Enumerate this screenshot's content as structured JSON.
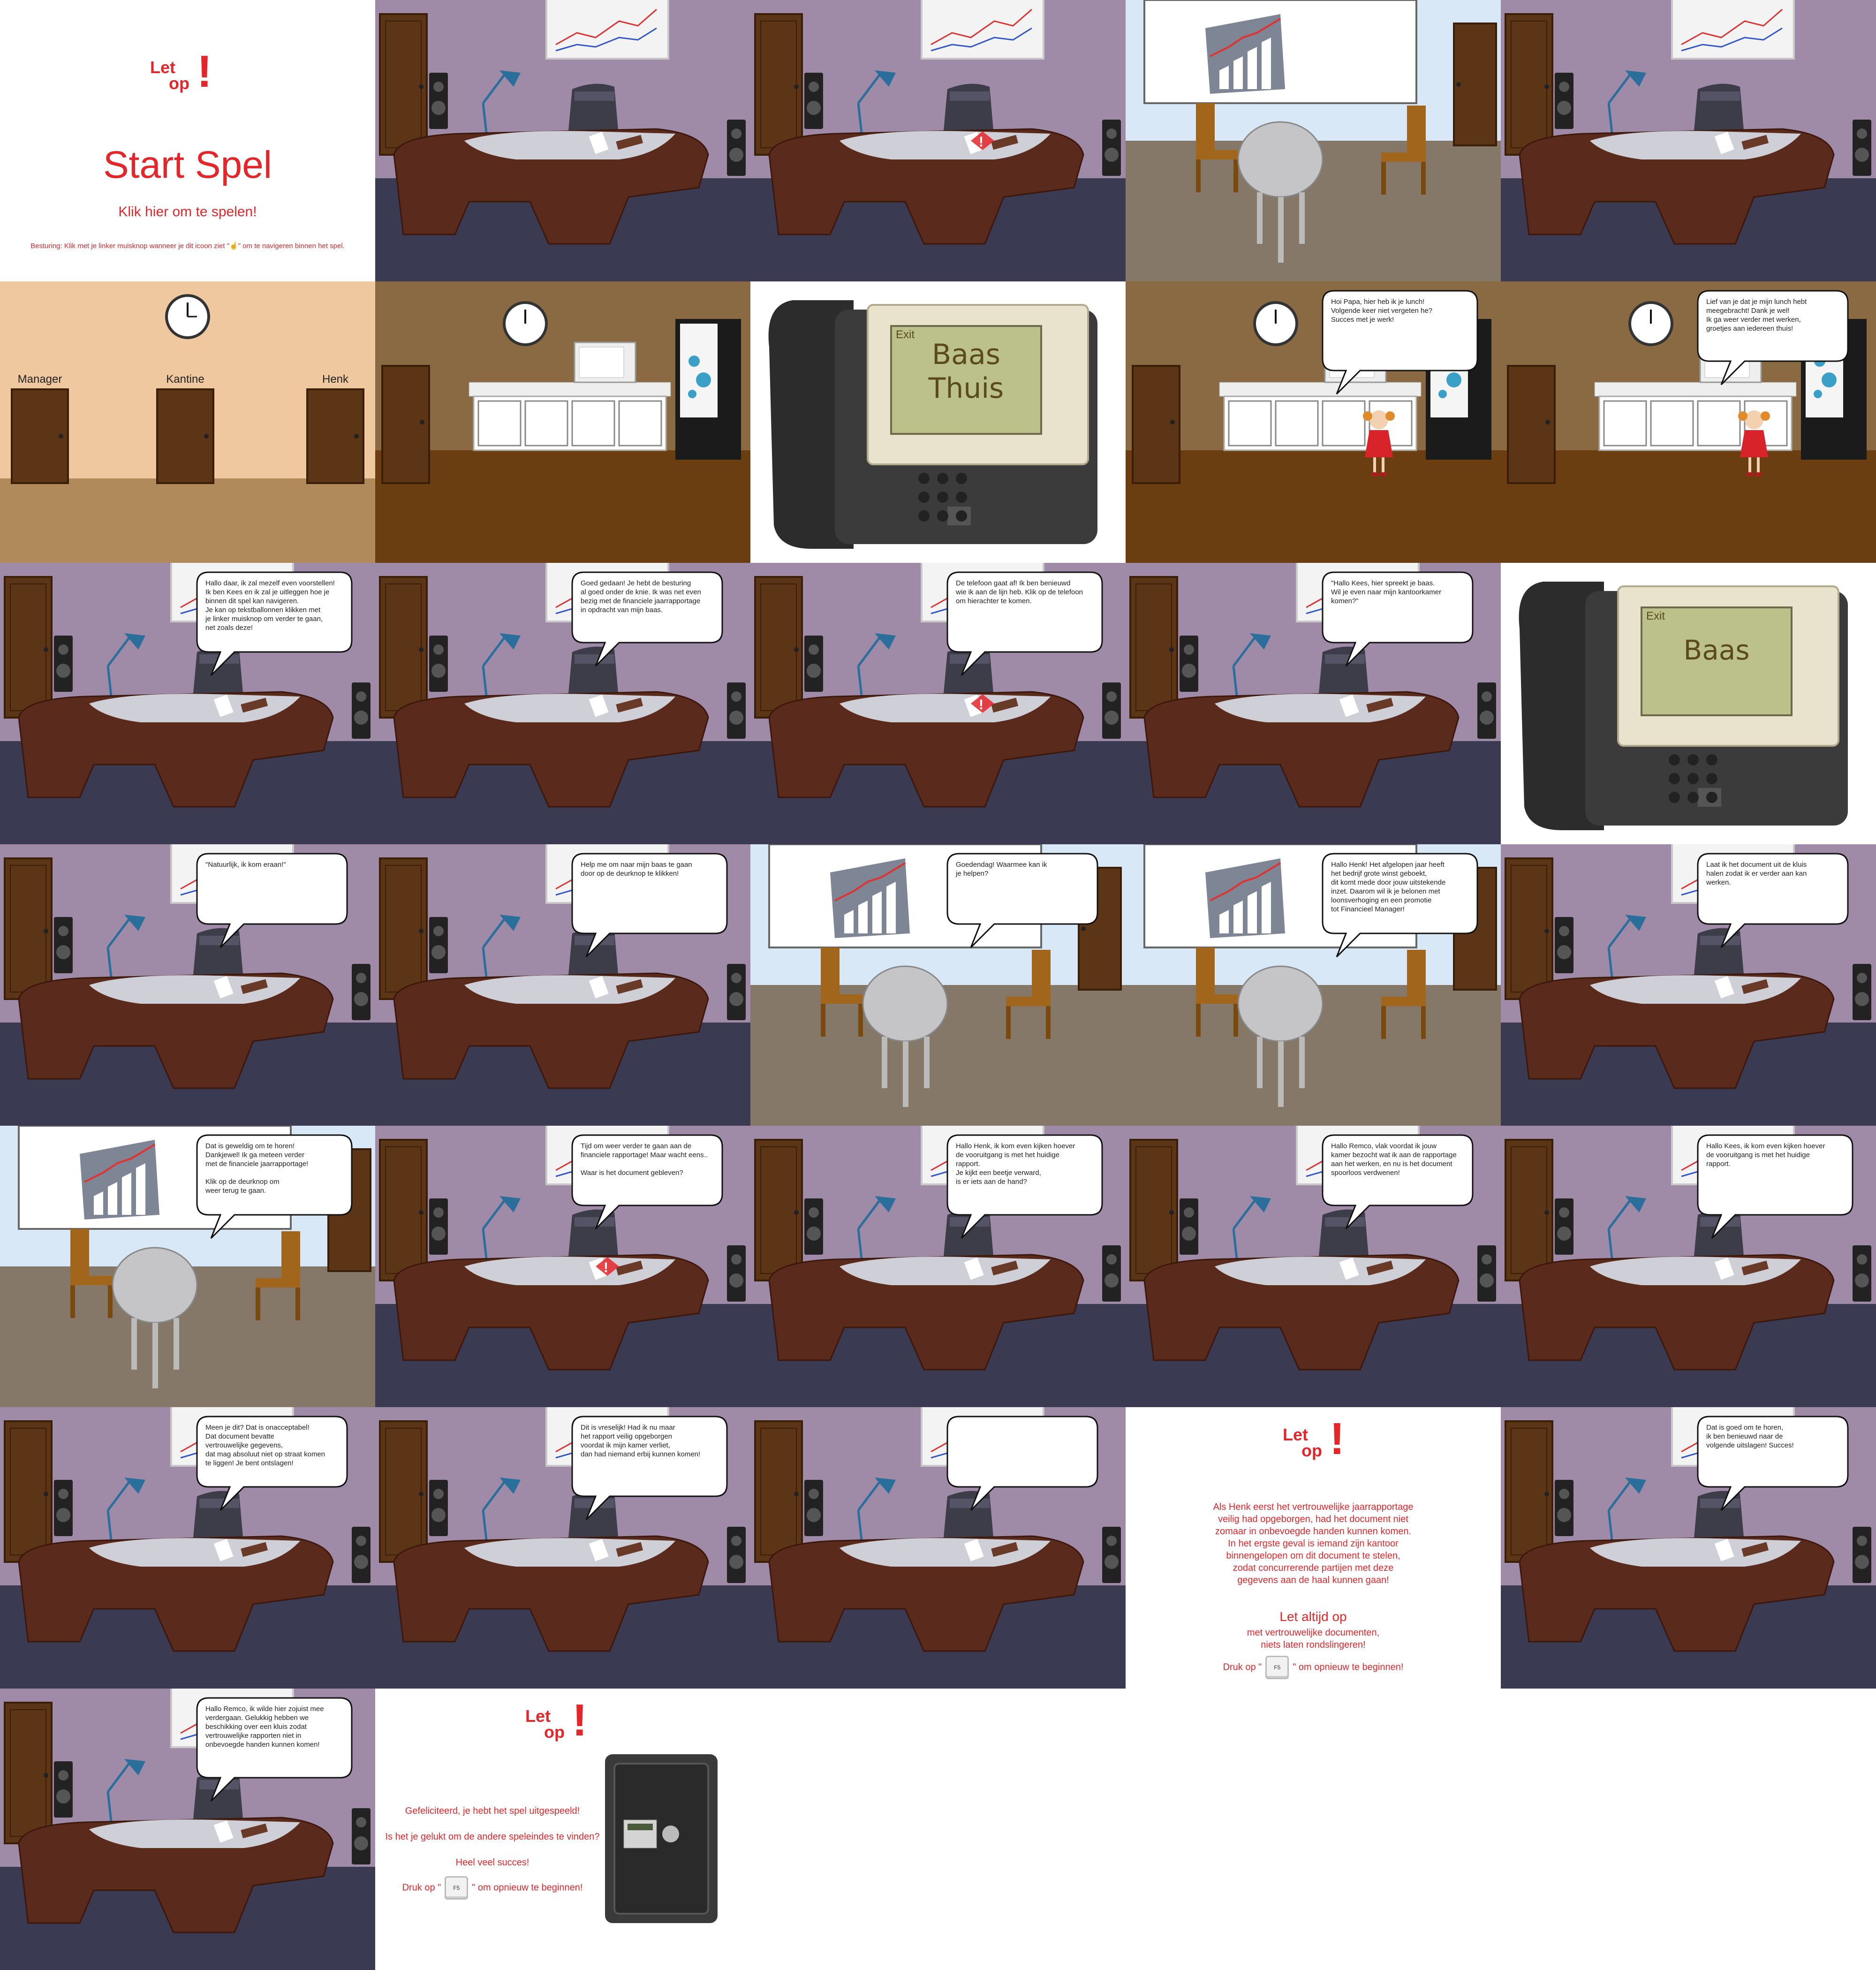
{
  "grid": {
    "columns": 5,
    "rows": 7
  },
  "logo": {
    "line1": "Let",
    "line2": "op"
  },
  "start": {
    "title": "Start Spel",
    "subtitle": "Klik hier om te spelen!",
    "controls_pre": "Besturing: Klik met je linker muisknop wanneer je dit icoon ziet \"",
    "controls_post": "\" om te navigeren binnen het spel.",
    "characters": [
      "boy-blue",
      "man-suit",
      "phone",
      "man-waving",
      "girl-red",
      "safe",
      "photo",
      "speaker",
      "no-sound"
    ]
  },
  "hallway": {
    "doors": [
      "Manager",
      "Kantine",
      "Henk"
    ]
  },
  "phone_home": {
    "exit": "Exit",
    "screen": "Baas\nThuis"
  },
  "phone_boss": {
    "exit": "Exit",
    "screen": "Baas"
  },
  "panels": [
    {
      "id": "start",
      "scene": "start"
    },
    {
      "id": "office-1",
      "scene": "office"
    },
    {
      "id": "office-alert",
      "scene": "office",
      "alert": true
    },
    {
      "id": "meeting-1",
      "scene": "meeting"
    },
    {
      "id": "office-2",
      "scene": "office"
    },
    {
      "id": "hallway",
      "scene": "hallway"
    },
    {
      "id": "kitchen-1",
      "scene": "kitchen"
    },
    {
      "id": "phone-home",
      "scene": "phone-home"
    },
    {
      "id": "kitchen-girl",
      "scene": "kitchen",
      "girl": true,
      "bubble": "Hoi Papa, hier heb ik je lunch!\nVolgende keer niet vergeten he?\nSucces met je werk!"
    },
    {
      "id": "kitchen-thanks",
      "scene": "kitchen2",
      "girl": true,
      "bubble": "Lief van je dat je mijn lunch hebt\nmeegebracht! Dank je wel!\nIk ga weer verder met werken,\ngroetjes aan iedereen thuis!"
    },
    {
      "id": "office-intro",
      "scene": "office",
      "bubble": "Hallo daar, ik zal mezelf even voorstellen!\nIk ben Kees en ik zal je uitleggen hoe je\nbinnen dit spel kan navigeren.\nJe kan op tekstballonnen klikken met\nje linker muisknop om verder te gaan,\nnet zoals deze!"
    },
    {
      "id": "office-report",
      "scene": "office",
      "bubble": "Goed gedaan! Je hebt de besturing\nal goed onder de knie. Ik was net even\nbezig met de financiele jaarrapportage\nin opdracht van mijn baas."
    },
    {
      "id": "office-phone",
      "scene": "office",
      "alert": true,
      "bubble": "De telefoon gaat af! Ik ben benieuwd\nwie ik aan de lijn heb. Klik op de telefoon\nom hierachter te komen."
    },
    {
      "id": "office-boss-call",
      "scene": "office",
      "bubble": "\"Hallo Kees, hier spreekt je baas.\nWil je even naar mijn kantoorkamer\nkomen?\""
    },
    {
      "id": "phone-boss",
      "scene": "phone-boss"
    },
    {
      "id": "office-coming",
      "scene": "office",
      "bubble": "\"Natuurlijk, ik kom eraan!\""
    },
    {
      "id": "office-help",
      "scene": "office",
      "bubble": "Help me om naar mijn baas te gaan\ndoor op de deurknop te klikken!"
    },
    {
      "id": "meeting-hello",
      "scene": "meeting",
      "bubble": "Goedendag! Waarmee kan  ik\nje helpen?"
    },
    {
      "id": "meeting-promo",
      "scene": "meeting",
      "bubble": "Hallo Henk! Het afgelopen jaar heeft\nhet bedrijf grote winst geboekt,\ndit komt mede door jouw uitstekende\ninzet. Daarom wil ik je belonen met\nloonsverhoging en een promotie\ntot Financieel Manager!"
    },
    {
      "id": "office-safe",
      "scene": "office",
      "bubble": "Laat ik het document uit de kluis\nhalen zodat ik er verder aan kan\nwerken."
    },
    {
      "id": "meeting-great",
      "scene": "meeting",
      "bubble": "Dat is geweldig om te horen!\nDankjewel! Ik ga meteen verder\nmet de financiele jaarrapportage!\n\nKlik op de deurknop om\nweer terug te gaan."
    },
    {
      "id": "office-where",
      "scene": "office",
      "alert": true,
      "bubble": "Tijd om weer verder te gaan aan de\nfinanciele rapportage! Maar wacht eens..\n\nWaar is het document gebleven?"
    },
    {
      "id": "office-henk",
      "scene": "office",
      "bubble": "Hallo Henk, ik kom even kijken hoever\nde vooruitgang is met het huidige\nrapport.\nJe kijkt een beetje verward,\nis er iets aan de hand?"
    },
    {
      "id": "office-remco",
      "scene": "office",
      "bubble": "Hallo Remco, vlak voordat ik jouw\nkamer bezocht wat ik aan de rapportage\naan het werken, en nu is het document\nspoorloos verdwenen!"
    },
    {
      "id": "office-kees",
      "scene": "office",
      "bubble": "Hallo Kees, ik kom even kijken hoever\nde vooruitgang is met het huidige\nrapport."
    },
    {
      "id": "office-fired",
      "scene": "office",
      "bubble": "Meen je dit? Dat is onacceptabel!\nDat document bevatte\nvertrouwelijke gegevens,\ndat mag absoluut niet op straat komen\nte liggen! Je bent ontslagen!"
    },
    {
      "id": "office-sorry",
      "scene": "office",
      "bubble": "Dit is vreselijk! Had ik nu maar\nhet rapport veilig opgeborgen\nvoordat ik mijn kamer verliet,\ndan had niemand erbij kunnen komen!"
    },
    {
      "id": "office-empty",
      "scene": "office",
      "bubble": ""
    },
    {
      "id": "end-bad",
      "scene": "end-bad"
    },
    {
      "id": "office-good",
      "scene": "office",
      "bubble": "Dat is goed om te horen,\nik ben benieuwd naar de\nvolgende uitslagen! Succes!"
    },
    {
      "id": "office-safe2",
      "scene": "office",
      "bubble": "Hallo Remco, ik wilde hier zojuist mee\nverdergaan. Gelukkig hebben we\nbeschikking over een kluis zodat\nvertrouwelijke rapporten niet in\nonbevoegde handen kunnen komen!"
    },
    {
      "id": "end-good",
      "scene": "end-good"
    }
  ],
  "end_bad": {
    "text": "Als Henk eerst het vertrouwelijke jaarrapportage\nveilig had opgeborgen, had het document niet\nzomaar in onbevoegde handen kunnen komen.\nIn het ergste geval is iemand zijn kantoor\nbinnengelopen om dit document te stelen,\nzodat concurrerende partijen met deze\ngegevens aan de haal kunnen gaan!",
    "heading": "Let altijd op",
    "sub": "met vertrouwelijke documenten,\nniets laten rondslingeren!",
    "restart_pre": "Druk op \"",
    "key": "F5",
    "restart_post": "\" om opnieuw te beginnen!"
  },
  "end_good": {
    "line1": "Gefeliciteerd, je hebt het spel uitgespeeld!",
    "line2": "Is het je gelukt om de andere speleindes te vinden?",
    "line3": "Heel veel succes!",
    "restart_pre": "Druk op \"",
    "key": "F5",
    "restart_post": "\" om opnieuw te beginnen!"
  },
  "colors": {
    "wall_office": "#9f8aa8",
    "floor_office": "#3a3a52",
    "desk": "#5a2a1c",
    "door": "#5c3416",
    "wall_meeting": "#d8e8f6",
    "floor_meeting": "#857868",
    "wall_hall": "#f0c8a0",
    "floor_hall": "#b08a5a",
    "wall_kitchen": "#8a6a42",
    "floor_kitchen": "#6b3e12",
    "accent_red": "#e4262b"
  }
}
